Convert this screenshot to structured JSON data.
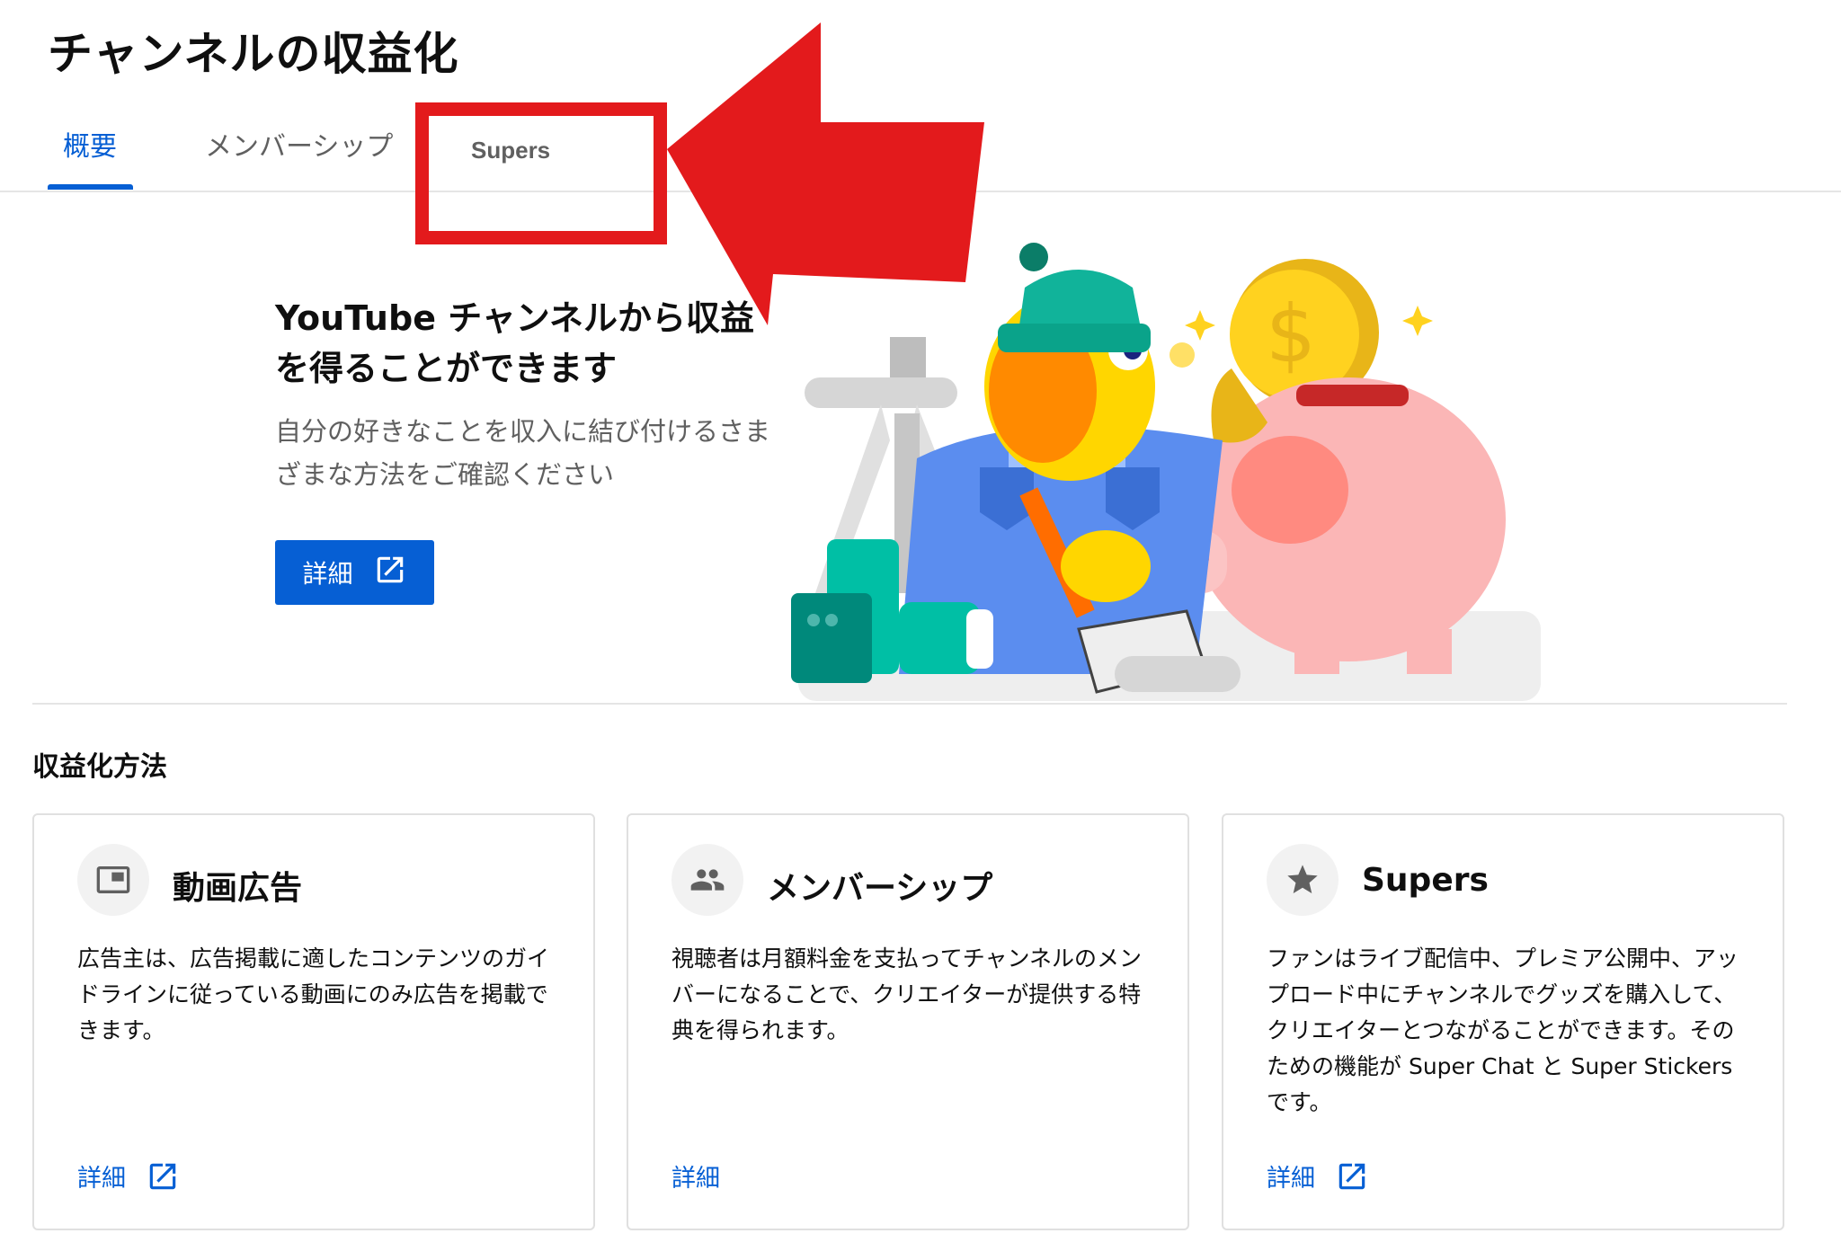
{
  "page": {
    "title": "チャンネルの収益化"
  },
  "tabs": [
    {
      "label": "概要",
      "active": true
    },
    {
      "label": "メンバーシップ",
      "active": false
    },
    {
      "label": "Supers",
      "active": false
    }
  ],
  "hero": {
    "title": "YouTube チャンネルから収益を得ることができます",
    "subtitle": "自分の好きなことを収入に結び付けるさまざまな方法をご確認ください",
    "button_label": "詳細"
  },
  "section": {
    "title": "収益化方法"
  },
  "cards": [
    {
      "icon": "video-ad-icon",
      "title": "動画広告",
      "description": "広告主は、広告掲載に適したコンテンツのガイドラインに従っている動画にのみ広告を掲載できます。",
      "link_label": "詳細",
      "link_external": true
    },
    {
      "icon": "people-icon",
      "title": "メンバーシップ",
      "description": "視聴者は月額料金を支払ってチャンネルのメンバーになることで、クリエイターが提供する特典を得られます。",
      "link_label": "詳細",
      "link_external": false
    },
    {
      "icon": "star-icon",
      "title": "Supers",
      "description": "ファンはライブ配信中、プレミア公開中、アップロード中にチャンネルでグッズを購入して、クリエイターとつながることができます。そのための機能が Super Chat と Super Stickers です。",
      "link_label": "詳細",
      "link_external": true
    }
  ],
  "colors": {
    "accent": "#065fd4",
    "annotation_red": "#e31a1c",
    "text_secondary": "#606060",
    "divider": "#e5e5e5"
  }
}
